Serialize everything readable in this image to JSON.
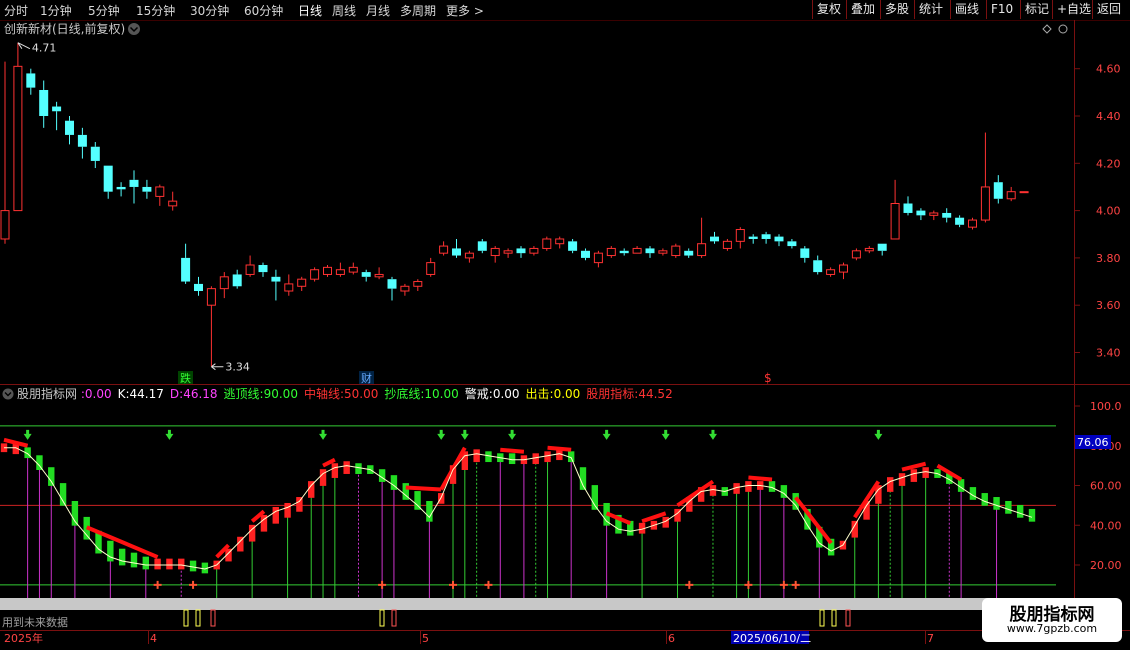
{
  "toolbar": {
    "periods": [
      "分时",
      "1分钟",
      "5分钟",
      "15分钟",
      "30分钟",
      "60分钟",
      "日线",
      "周线",
      "月线",
      "多周期",
      "更多"
    ],
    "active_period": "日线",
    "more_arrow": ">",
    "right_buttons": [
      "复权",
      "叠加",
      "多股",
      "统计",
      "画线",
      "F10",
      "标记",
      "+自选",
      "返回"
    ]
  },
  "main_chart": {
    "title": "创新新材(日线,前复权)",
    "high_label": "4.71",
    "low_label": "3.34",
    "y_ticks": [
      "4.60",
      "4.40",
      "4.20",
      "4.00",
      "3.80",
      "3.60",
      "3.40"
    ],
    "markers": [
      {
        "text": "跌",
        "color": "#33ff33",
        "bg": "#004400"
      },
      {
        "text": "财",
        "color": "#66aaff",
        "bg": "#002244"
      },
      {
        "text": "$",
        "color": "#ff3333",
        "bg": "#000000"
      }
    ],
    "candles": [
      {
        "o": 3.88,
        "c": 4.0,
        "h": 4.63,
        "l": 3.86
      },
      {
        "o": 4.0,
        "c": 4.61,
        "h": 4.71,
        "l": 4.01
      },
      {
        "o": 4.58,
        "c": 4.52,
        "h": 4.6,
        "l": 4.49
      },
      {
        "o": 4.51,
        "c": 4.4,
        "h": 4.55,
        "l": 4.35
      },
      {
        "o": 4.44,
        "c": 4.42,
        "h": 4.46,
        "l": 4.34
      },
      {
        "o": 4.38,
        "c": 4.32,
        "h": 4.4,
        "l": 4.28
      },
      {
        "o": 4.32,
        "c": 4.27,
        "h": 4.35,
        "l": 4.22
      },
      {
        "o": 4.27,
        "c": 4.21,
        "h": 4.29,
        "l": 4.18
      },
      {
        "o": 4.19,
        "c": 4.08,
        "h": 4.19,
        "l": 4.05
      },
      {
        "o": 4.1,
        "c": 4.09,
        "h": 4.12,
        "l": 4.06
      },
      {
        "o": 4.13,
        "c": 4.1,
        "h": 4.17,
        "l": 4.03
      },
      {
        "o": 4.1,
        "c": 4.08,
        "h": 4.13,
        "l": 4.05
      },
      {
        "o": 4.06,
        "c": 4.1,
        "h": 4.11,
        "l": 4.02
      },
      {
        "o": 4.02,
        "c": 4.04,
        "h": 4.08,
        "l": 4.0
      },
      {
        "o": 3.8,
        "c": 3.7,
        "h": 3.86,
        "l": 3.69
      },
      {
        "o": 3.69,
        "c": 3.66,
        "h": 3.72,
        "l": 3.64
      },
      {
        "o": 3.6,
        "c": 3.67,
        "h": 3.68,
        "l": 3.34
      },
      {
        "o": 3.67,
        "c": 3.72,
        "h": 3.74,
        "l": 3.63
      },
      {
        "o": 3.73,
        "c": 3.68,
        "h": 3.75,
        "l": 3.67
      },
      {
        "o": 3.73,
        "c": 3.77,
        "h": 3.81,
        "l": 3.72
      },
      {
        "o": 3.77,
        "c": 3.74,
        "h": 3.78,
        "l": 3.72
      },
      {
        "o": 3.72,
        "c": 3.7,
        "h": 3.75,
        "l": 3.62
      },
      {
        "o": 3.66,
        "c": 3.69,
        "h": 3.73,
        "l": 3.64
      },
      {
        "o": 3.68,
        "c": 3.71,
        "h": 3.72,
        "l": 3.66
      },
      {
        "o": 3.71,
        "c": 3.75,
        "h": 3.76,
        "l": 3.7
      },
      {
        "o": 3.73,
        "c": 3.76,
        "h": 3.77,
        "l": 3.72
      },
      {
        "o": 3.73,
        "c": 3.75,
        "h": 3.78,
        "l": 3.72
      },
      {
        "o": 3.74,
        "c": 3.76,
        "h": 3.78,
        "l": 3.73
      },
      {
        "o": 3.74,
        "c": 3.72,
        "h": 3.75,
        "l": 3.7
      },
      {
        "o": 3.72,
        "c": 3.73,
        "h": 3.76,
        "l": 3.71
      },
      {
        "o": 3.71,
        "c": 3.67,
        "h": 3.72,
        "l": 3.62
      },
      {
        "o": 3.66,
        "c": 3.68,
        "h": 3.69,
        "l": 3.64
      },
      {
        "o": 3.68,
        "c": 3.7,
        "h": 3.71,
        "l": 3.66
      },
      {
        "o": 3.73,
        "c": 3.78,
        "h": 3.8,
        "l": 3.72
      },
      {
        "o": 3.82,
        "c": 3.85,
        "h": 3.87,
        "l": 3.81
      },
      {
        "o": 3.84,
        "c": 3.81,
        "h": 3.88,
        "l": 3.8
      },
      {
        "o": 3.8,
        "c": 3.82,
        "h": 3.83,
        "l": 3.78
      },
      {
        "o": 3.87,
        "c": 3.83,
        "h": 3.88,
        "l": 3.82
      },
      {
        "o": 3.81,
        "c": 3.84,
        "h": 3.85,
        "l": 3.78
      },
      {
        "o": 3.82,
        "c": 3.83,
        "h": 3.84,
        "l": 3.8
      },
      {
        "o": 3.84,
        "c": 3.82,
        "h": 3.85,
        "l": 3.8
      },
      {
        "o": 3.82,
        "c": 3.84,
        "h": 3.85,
        "l": 3.81
      },
      {
        "o": 3.84,
        "c": 3.88,
        "h": 3.89,
        "l": 3.83
      },
      {
        "o": 3.86,
        "c": 3.88,
        "h": 3.89,
        "l": 3.84
      },
      {
        "o": 3.87,
        "c": 3.83,
        "h": 3.88,
        "l": 3.82
      },
      {
        "o": 3.83,
        "c": 3.8,
        "h": 3.84,
        "l": 3.79
      },
      {
        "o": 3.78,
        "c": 3.82,
        "h": 3.83,
        "l": 3.76
      },
      {
        "o": 3.81,
        "c": 3.84,
        "h": 3.85,
        "l": 3.8
      },
      {
        "o": 3.83,
        "c": 3.82,
        "h": 3.84,
        "l": 3.81
      },
      {
        "o": 3.82,
        "c": 3.84,
        "h": 3.85,
        "l": 3.82
      },
      {
        "o": 3.84,
        "c": 3.82,
        "h": 3.85,
        "l": 3.8
      },
      {
        "o": 3.82,
        "c": 3.83,
        "h": 3.84,
        "l": 3.81
      },
      {
        "o": 3.81,
        "c": 3.85,
        "h": 3.86,
        "l": 3.8
      },
      {
        "o": 3.83,
        "c": 3.81,
        "h": 3.84,
        "l": 3.8
      },
      {
        "o": 3.81,
        "c": 3.86,
        "h": 3.97,
        "l": 3.8
      },
      {
        "o": 3.89,
        "c": 3.87,
        "h": 3.91,
        "l": 3.86
      },
      {
        "o": 3.84,
        "c": 3.87,
        "h": 3.88,
        "l": 3.83
      },
      {
        "o": 3.87,
        "c": 3.92,
        "h": 3.93,
        "l": 3.84
      },
      {
        "o": 3.89,
        "c": 3.88,
        "h": 3.9,
        "l": 3.86
      },
      {
        "o": 3.9,
        "c": 3.88,
        "h": 3.91,
        "l": 3.86
      },
      {
        "o": 3.89,
        "c": 3.87,
        "h": 3.9,
        "l": 3.85
      },
      {
        "o": 3.87,
        "c": 3.85,
        "h": 3.88,
        "l": 3.84
      },
      {
        "o": 3.84,
        "c": 3.8,
        "h": 3.85,
        "l": 3.78
      },
      {
        "o": 3.79,
        "c": 3.74,
        "h": 3.81,
        "l": 3.73
      },
      {
        "o": 3.73,
        "c": 3.75,
        "h": 3.76,
        "l": 3.72
      },
      {
        "o": 3.74,
        "c": 3.77,
        "h": 3.78,
        "l": 3.71
      },
      {
        "o": 3.8,
        "c": 3.83,
        "h": 3.84,
        "l": 3.79
      },
      {
        "o": 3.83,
        "c": 3.84,
        "h": 3.85,
        "l": 3.82
      },
      {
        "o": 3.86,
        "c": 3.83,
        "h": 3.86,
        "l": 3.81
      },
      {
        "o": 3.88,
        "c": 4.03,
        "h": 4.13,
        "l": 3.88
      },
      {
        "o": 4.03,
        "c": 3.99,
        "h": 4.06,
        "l": 3.98
      },
      {
        "o": 4.0,
        "c": 3.98,
        "h": 4.01,
        "l": 3.96
      },
      {
        "o": 3.98,
        "c": 3.99,
        "h": 4.0,
        "l": 3.96
      },
      {
        "o": 3.99,
        "c": 3.97,
        "h": 4.01,
        "l": 3.95
      },
      {
        "o": 3.97,
        "c": 3.94,
        "h": 3.98,
        "l": 3.93
      },
      {
        "o": 3.93,
        "c": 3.96,
        "h": 3.97,
        "l": 3.92
      },
      {
        "o": 3.96,
        "c": 4.1,
        "h": 4.33,
        "l": 3.95
      },
      {
        "o": 4.12,
        "c": 4.05,
        "h": 4.15,
        "l": 4.03
      },
      {
        "o": 4.05,
        "c": 4.08,
        "h": 4.1,
        "l": 4.04
      },
      {
        "o": 4.08,
        "c": 4.08,
        "h": 4.08,
        "l": 4.08
      }
    ]
  },
  "indicator": {
    "name": "股朋指标网",
    "params": [
      {
        "label": ":",
        "value": "0.00",
        "color": "#ff44ff"
      },
      {
        "label": "K:",
        "value": "44.17",
        "color": "#ffffff"
      },
      {
        "label": "D:",
        "value": "46.18",
        "color": "#ff44ff"
      },
      {
        "label": "逃顶线:",
        "value": "90.00",
        "color": "#33ff33"
      },
      {
        "label": "中轴线:",
        "value": "50.00",
        "color": "#ff3333"
      },
      {
        "label": "抄底线:",
        "value": "10.00",
        "color": "#33ff33"
      },
      {
        "label": "警戒:",
        "value": "0.00",
        "color": "#ffffff"
      },
      {
        "label": "出击:",
        "value": "0.00",
        "color": "#ffff00"
      },
      {
        "label": "股朋指标:",
        "value": "44.52",
        "color": "#ff3333"
      }
    ],
    "y_ticks": [
      "100.0",
      "80.00",
      "60.00",
      "40.00",
      "20.00"
    ],
    "current_value": "76.06",
    "top_line": 90,
    "mid_line": 50,
    "bottom_line": 10,
    "k_values": [
      79,
      79,
      76,
      70,
      62,
      52,
      42,
      35,
      28,
      24,
      22,
      21,
      20,
      20,
      20,
      20,
      19,
      18,
      20,
      26,
      32,
      38,
      43,
      47,
      49,
      52,
      60,
      66,
      69,
      70,
      69,
      68,
      64,
      60,
      55,
      50,
      44,
      54,
      68,
      75,
      76,
      75,
      74,
      73,
      73,
      74,
      75,
      76,
      74,
      60,
      50,
      42,
      38,
      37,
      38,
      40,
      42,
      46,
      52,
      57,
      58,
      57,
      59,
      60,
      60,
      59,
      56,
      50,
      40,
      31,
      27,
      30,
      40,
      50,
      58,
      62,
      64,
      66,
      67,
      66,
      63,
      59,
      55,
      52,
      50,
      48,
      46,
      44
    ],
    "d_values": [
      79,
      78,
      77,
      73,
      67,
      59,
      50,
      42,
      35,
      30,
      26,
      24,
      22,
      21,
      21,
      21,
      20,
      19,
      20,
      24,
      29,
      34,
      39,
      43,
      46,
      49,
      56,
      62,
      66,
      68,
      68,
      68,
      66,
      63,
      59,
      55,
      50,
      53,
      63,
      70,
      74,
      74,
      74,
      74,
      73,
      73,
      74,
      75,
      75,
      67,
      58,
      49,
      43,
      40,
      39,
      40,
      41,
      44,
      49,
      54,
      57,
      57,
      58,
      59,
      60,
      60,
      58,
      54,
      46,
      37,
      31,
      30,
      36,
      45,
      53,
      59,
      62,
      64,
      66,
      66,
      64,
      61,
      57,
      54,
      52,
      50,
      48,
      46
    ],
    "arrow_bars": [
      2,
      14,
      27,
      37,
      39,
      43,
      51,
      56,
      60,
      74
    ],
    "cross_bars": [
      13,
      16,
      32,
      38,
      41,
      58,
      63,
      66,
      67
    ]
  },
  "time_axis": {
    "labels": [
      "2025年",
      "4",
      "5",
      "6",
      "7"
    ],
    "highlight": "2025/06/10/二",
    "future_note": "用到未来数据"
  },
  "watermark": {
    "title": "股朋指标网",
    "url": "www.7gpzb.com"
  },
  "colors": {
    "up": "#ff3232",
    "down": "#54ffff",
    "border": "#7a1010",
    "grid": "#3a0000"
  }
}
